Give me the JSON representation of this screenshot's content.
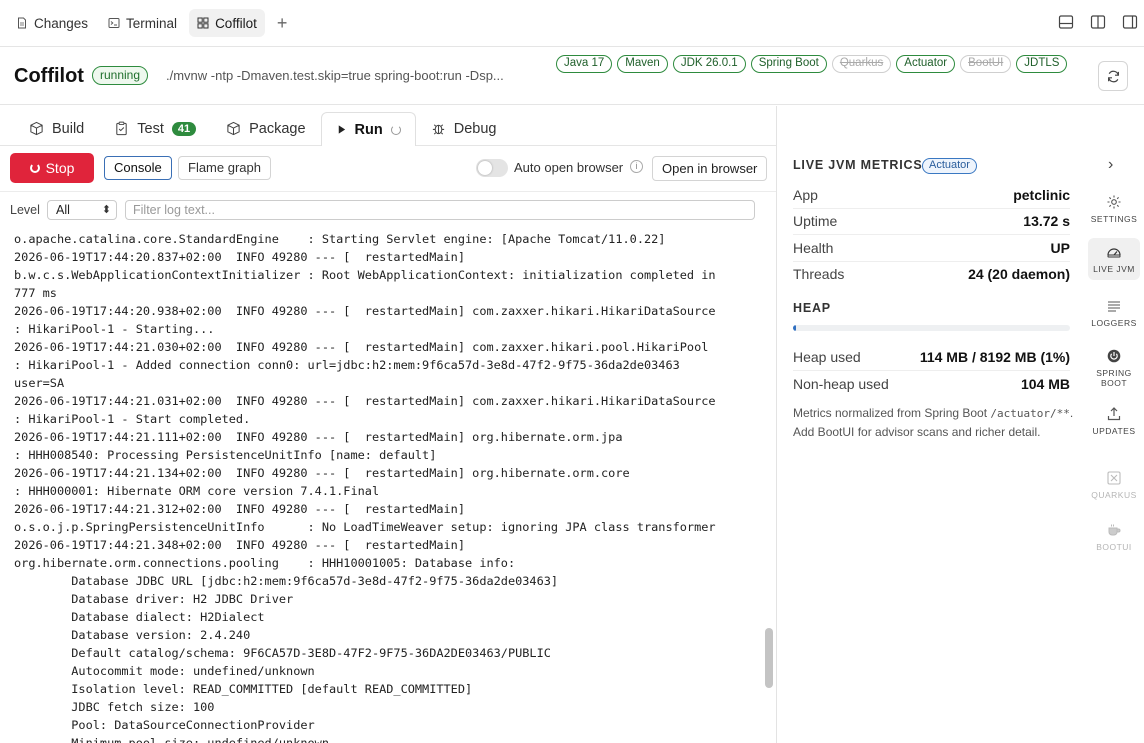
{
  "top_tabs": [
    {
      "label": "Changes",
      "icon": "document-icon"
    },
    {
      "label": "Terminal",
      "icon": "terminal-icon"
    },
    {
      "label": "Coffilot",
      "icon": "blocks-icon",
      "active": true
    }
  ],
  "header": {
    "title": "Coffilot",
    "status": "running",
    "command": "./mvnw -ntp -Dmaven.test.skip=true spring-boot:run -Dsp...",
    "badges": [
      {
        "label": "Java 17",
        "enabled": true
      },
      {
        "label": "Maven",
        "enabled": true
      },
      {
        "label": "JDK 26.0.1",
        "enabled": true
      },
      {
        "label": "Spring Boot",
        "enabled": true
      },
      {
        "label": "Quarkus",
        "enabled": false
      },
      {
        "label": "Actuator",
        "enabled": true
      },
      {
        "label": "BootUI",
        "enabled": false
      },
      {
        "label": "JDTLS",
        "enabled": true
      }
    ]
  },
  "sub_tabs": {
    "build": "Build",
    "test": "Test",
    "test_count": "41",
    "package": "Package",
    "run": "Run",
    "debug": "Debug"
  },
  "controls": {
    "stop": "Stop",
    "console": "Console",
    "flame_graph": "Flame graph",
    "auto_open": "Auto open browser",
    "auto_open_enabled": false,
    "info": "i",
    "open_browser": "Open in browser"
  },
  "filter": {
    "level_label": "Level",
    "level_value": "All",
    "placeholder": "Filter log text..."
  },
  "log_lines": [
    "o.apache.catalina.core.StandardEngine    : Starting Servlet engine: [Apache Tomcat/11.0.22]",
    "2026-06-19T17:44:20.837+02:00  INFO 49280 --- [  restartedMain]",
    "b.w.c.s.WebApplicationContextInitializer : Root WebApplicationContext: initialization completed in",
    "777 ms",
    "2026-06-19T17:44:20.938+02:00  INFO 49280 --- [  restartedMain] com.zaxxer.hikari.HikariDataSource",
    ": HikariPool-1 - Starting...",
    "2026-06-19T17:44:21.030+02:00  INFO 49280 --- [  restartedMain] com.zaxxer.hikari.pool.HikariPool",
    ": HikariPool-1 - Added connection conn0: url=jdbc:h2:mem:9f6ca57d-3e8d-47f2-9f75-36da2de03463",
    "user=SA",
    "2026-06-19T17:44:21.031+02:00  INFO 49280 --- [  restartedMain] com.zaxxer.hikari.HikariDataSource",
    ": HikariPool-1 - Start completed.",
    "2026-06-19T17:44:21.111+02:00  INFO 49280 --- [  restartedMain] org.hibernate.orm.jpa",
    ": HHH008540: Processing PersistenceUnitInfo [name: default]",
    "2026-06-19T17:44:21.134+02:00  INFO 49280 --- [  restartedMain] org.hibernate.orm.core",
    ": HHH000001: Hibernate ORM core version 7.4.1.Final",
    "2026-06-19T17:44:21.312+02:00  INFO 49280 --- [  restartedMain]",
    "o.s.o.j.p.SpringPersistenceUnitInfo      : No LoadTimeWeaver setup: ignoring JPA class transformer",
    "2026-06-19T17:44:21.348+02:00  INFO 49280 --- [  restartedMain]",
    "org.hibernate.orm.connections.pooling    : HHH10001005: Database info:",
    "        Database JDBC URL [jdbc:h2:mem:9f6ca57d-3e8d-47f2-9f75-36da2de03463]",
    "        Database driver: H2 JDBC Driver",
    "        Database dialect: H2Dialect",
    "        Database version: 2.4.240",
    "        Default catalog/schema: 9F6CA57D-3E8D-47F2-9F75-36DA2DE03463/PUBLIC",
    "        Autocommit mode: undefined/unknown",
    "        Isolation level: READ_COMMITTED [default READ_COMMITTED]",
    "        JDBC fetch size: 100",
    "        Pool: DataSourceConnectionProvider",
    "        Minimum pool size: undefined/unknown"
  ],
  "metrics": {
    "title": "LIVE JVM METRICS",
    "badge": "Actuator",
    "rows": [
      {
        "key": "App",
        "value": "petclinic"
      },
      {
        "key": "Uptime",
        "value": "13.72 s"
      },
      {
        "key": "Health",
        "value": "UP"
      },
      {
        "key": "Threads",
        "value": "24 (20 daemon)"
      }
    ],
    "heap_title": "HEAP",
    "heap_fraction": 0.01,
    "heap_rows": [
      {
        "key": "Heap used",
        "value": "114 MB / 8192 MB (1%)"
      },
      {
        "key": "Non-heap used",
        "value": "104 MB"
      }
    ],
    "note_prefix": "Metrics normalized from Spring Boot",
    "note_code": "/actuator/**",
    "note_suffix": ". Add BootUI for advisor scans and richer detail."
  },
  "rail": [
    {
      "label": "SETTINGS",
      "icon": "gear-icon"
    },
    {
      "label": "LIVE JVM",
      "icon": "gauge-icon"
    },
    {
      "label": "LOGGERS",
      "icon": "lines-icon"
    },
    {
      "label": "SPRING BOOT",
      "icon": "power-icon"
    },
    {
      "label": "UPDATES",
      "icon": "upload-icon"
    },
    {
      "label": "QUARKUS",
      "icon": "quarkus-icon"
    },
    {
      "label": "BOOTUI",
      "icon": "cup-icon"
    }
  ]
}
